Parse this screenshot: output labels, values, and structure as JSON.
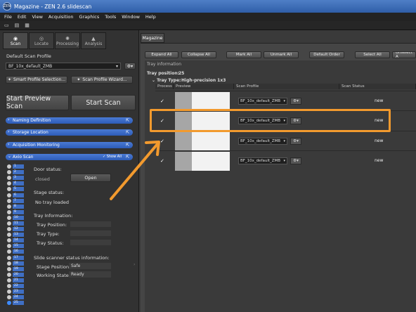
{
  "window": {
    "title": "Magazine - ZEN 2.6 slidescan",
    "logo": "ZEN"
  },
  "menu": [
    "File",
    "Edit",
    "View",
    "Acquisition",
    "Graphics",
    "Tools",
    "Window",
    "Help"
  ],
  "toolbar": {
    "icons": [
      "open-icon",
      "save-icon",
      "layout-icon"
    ],
    "glyphs": [
      "▭",
      "▤",
      "▦"
    ]
  },
  "left_tabs": [
    {
      "label": "Scan",
      "icon": "scan-icon",
      "glyph": "◉"
    },
    {
      "label": "Locate",
      "icon": "locate-icon",
      "glyph": "◎"
    },
    {
      "label": "Processing",
      "icon": "processing-icon",
      "glyph": "✺"
    },
    {
      "label": "Analysis",
      "icon": "analysis-icon",
      "glyph": "▲"
    }
  ],
  "scan": {
    "profile_label": "Default Scan Profile",
    "profile_value": "BF_10x_default_ZMB",
    "smart_profile_btn": "Smart Profile Selection...",
    "profile_wizard_btn": "Scan Profile Wizard...",
    "start_preview_btn": "Start Preview Scan",
    "start_scan_btn": "Start Scan",
    "gear_glyph": "⚙▾",
    "sections": [
      "Naming Definition",
      "Storage Location",
      "Acquisition Monitoring"
    ],
    "axio_section": "Axio Scan",
    "show_all": "Show All",
    "door_status_label": "Door status:",
    "door_value": "closed",
    "open_btn": "Open",
    "stage_status_label": "Stage status:",
    "stage_value": "No tray loaded",
    "tray_info_label": "Tray Information:",
    "tray_position_label": "Tray Position:",
    "tray_type_label": "Tray Type:",
    "tray_status_label": "Tray Status:",
    "slide_scanner_label": "Slide scanner status information:",
    "stage_position_label": "Stage Position:",
    "stage_position_value": "Safe",
    "working_state_label": "Working State:",
    "working_state_value": "Ready"
  },
  "slots": [
    "1",
    "2",
    "3",
    "4",
    "5",
    "6",
    "7",
    "8",
    "9",
    "10",
    "11",
    "12",
    "13",
    "14",
    "15",
    "16",
    "17",
    "18",
    "19",
    "20",
    "21",
    "22",
    "23",
    "24",
    "25"
  ],
  "selected_slot": "25",
  "magazine": {
    "tab": "Magazine",
    "buttons": [
      "Expand All",
      "Collapse All",
      "Mark All",
      "Unmark All",
      "Default Order",
      "Select All",
      "Unselect A"
    ],
    "tray_info": "Tray information",
    "tray_position_label": "Tray position:",
    "tray_position_value": "25",
    "tray_type_label": "Tray Type:",
    "tray_type_value": "High-precision 1x3",
    "columns": [
      "Process",
      "Preview",
      "Scan Profile",
      "Scan Status"
    ],
    "rows": [
      {
        "checked": "✓",
        "profile": "BF_10x_default_ZMB",
        "status": "new"
      },
      {
        "checked": "✓",
        "profile": "BF_10x_default_ZMB",
        "status": "new"
      },
      {
        "checked": "✓",
        "profile": "BF_10x_default_ZMB",
        "status": "new"
      },
      {
        "checked": "✓",
        "profile": "BF_10x_default_ZMB",
        "status": "new"
      }
    ]
  },
  "colors": {
    "highlight": "#f29a2e",
    "accent": "#3d6fc8"
  }
}
